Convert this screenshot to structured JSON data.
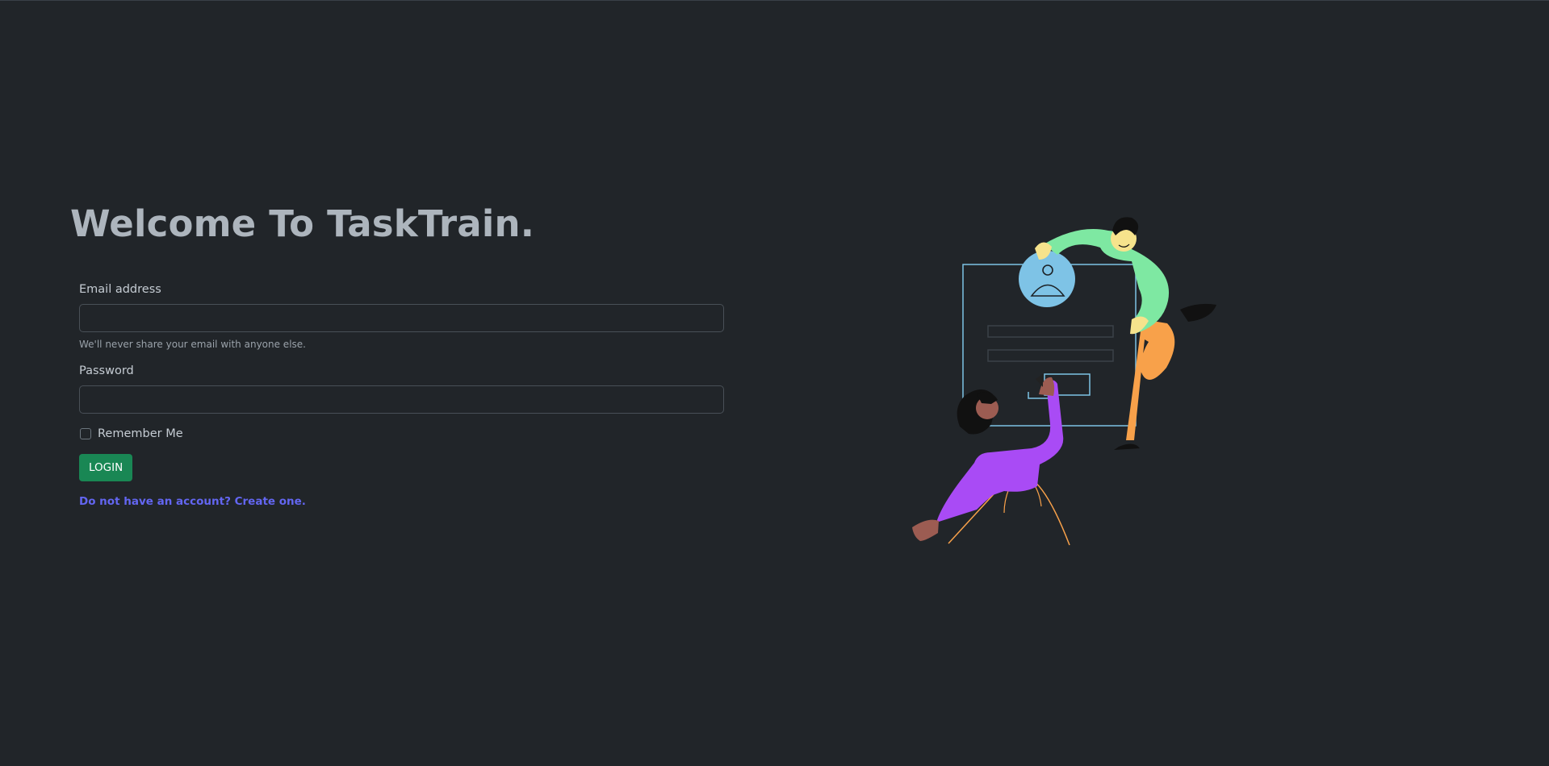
{
  "heading": "Welcome To TaskTrain.",
  "form": {
    "email_label": "Email address",
    "email_value": "",
    "email_help": "We'll never share your email with anyone else.",
    "password_label": "Password",
    "password_value": "",
    "remember_label": "Remember Me",
    "login_button": "LOGIN",
    "signup_link": "Do not have an account? Create one."
  },
  "colors": {
    "background": "#212529",
    "button": "#198754",
    "link": "#6366f1",
    "heading": "#adb5bd"
  },
  "illustration": {
    "icon": "login-illustration-icon"
  }
}
